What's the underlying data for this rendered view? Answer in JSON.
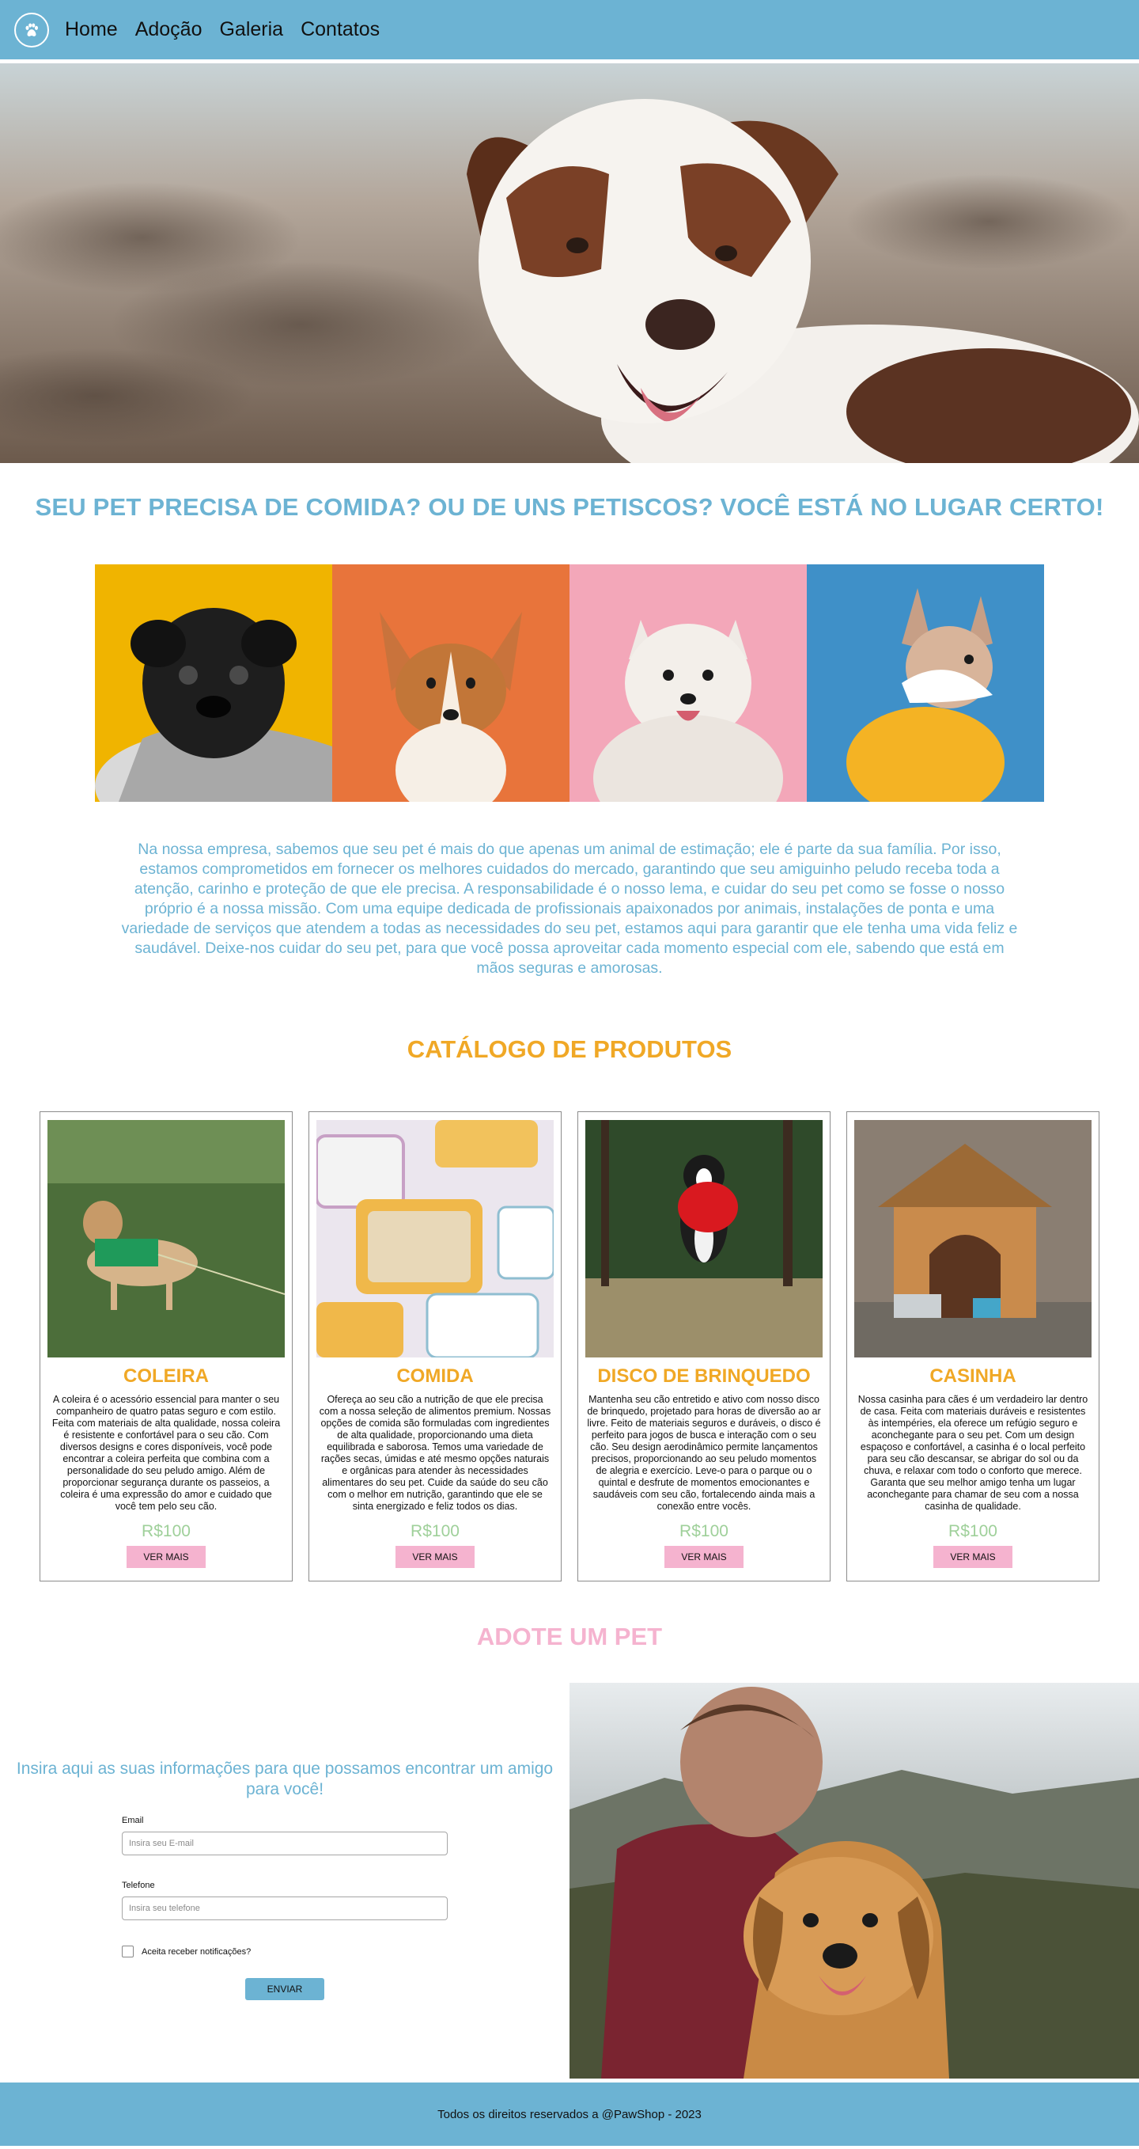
{
  "nav": {
    "logo_icon": "paw-icon",
    "links": [
      "Home",
      "Adoção",
      "Galeria",
      "Contatos"
    ]
  },
  "hero": {
    "image": "dog-hero-photo"
  },
  "tagline": "SEU PET PRECISA DE COMIDA? OU DE UNS PETISCOS? VOCÊ ESTÁ NO LUGAR CERTO!",
  "pets": [
    "pug",
    "corgi",
    "samoyed",
    "french-bulldog"
  ],
  "about": "Na nossa empresa, sabemos que seu pet é mais do que apenas um animal de estimação; ele é parte da sua família. Por isso, estamos comprometidos em fornecer os melhores cuidados do mercado, garantindo que seu amiguinho peludo receba toda a atenção, carinho e proteção de que ele precisa. A responsabilidade é o nosso lema, e cuidar do seu pet como se fosse o nosso próprio é a nossa missão. Com uma equipe dedicada de profissionais apaixonados por animais, instalações de ponta e uma variedade de serviços que atendem a todas as necessidades do seu pet, estamos aqui para garantir que ele tenha uma vida feliz e saudável. Deixe-nos cuidar do seu pet, para que você possa aproveitar cada momento especial com ele, sabendo que está em mãos seguras e amorosas.",
  "catalog": {
    "title": "CATÁLOGO DE PRODUTOS",
    "products": [
      {
        "name": "COLEIRA",
        "description": "A coleira é o acessório essencial para manter o seu companheiro de quatro patas seguro e com estilo. Feita com materiais de alta qualidade, nossa coleira é resistente e confortável para o seu cão. Com diversos designs e cores disponíveis, você pode encontrar a coleira perfeita que combina com a personalidade do seu peludo amigo. Além de proporcionar segurança durante os passeios, a coleira é uma expressão do amor e cuidado que você tem pelo seu cão.",
        "price": "R$100",
        "button": "VER MAIS"
      },
      {
        "name": "COMIDA",
        "description": "Ofereça ao seu cão a nutrição de que ele precisa com a nossa seleção de alimentos premium. Nossas opções de comida são formuladas com ingredientes de alta qualidade, proporcionando uma dieta equilibrada e saborosa. Temos uma variedade de rações secas, úmidas e até mesmo opções naturais e orgânicas para atender às necessidades alimentares do seu pet. Cuide da saúde do seu cão com o melhor em nutrição, garantindo que ele se sinta energizado e feliz todos os dias.",
        "price": "R$100",
        "button": "VER MAIS"
      },
      {
        "name": "DISCO DE BRINQUEDO",
        "description": "Mantenha seu cão entretido e ativo com nosso disco de brinquedo, projetado para horas de diversão ao ar livre. Feito de materiais seguros e duráveis, o disco é perfeito para jogos de busca e interação com o seu cão. Seu design aerodinâmico permite lançamentos precisos, proporcionando ao seu peludo momentos de alegria e exercício. Leve-o para o parque ou o quintal e desfrute de momentos emocionantes e saudáveis com seu cão, fortalecendo ainda mais a conexão entre vocês.",
        "price": "R$100",
        "button": "VER MAIS"
      },
      {
        "name": "CASINHA",
        "description": "Nossa casinha para cães é um verdadeiro lar dentro de casa. Feita com materiais duráveis e resistentes às intempéries, ela oferece um refúgio seguro e aconchegante para o seu pet. Com um design espaçoso e confortável, a casinha é o local perfeito para seu cão descansar, se abrigar do sol ou da chuva, e relaxar com todo o conforto que merece. Garanta que seu melhor amigo tenha um lugar aconchegante para chamar de seu com a nossa casinha de qualidade.",
        "price": "R$100",
        "button": "VER MAIS"
      }
    ]
  },
  "adopt": {
    "title": "ADOTE UM PET",
    "intro": "Insira aqui as suas informações para que possamos encontrar um amigo para você!",
    "email_label": "Email",
    "email_placeholder": "Insira seu E-mail",
    "phone_label": "Telefone",
    "phone_placeholder": "Insira seu telefone",
    "checkbox_label": "Aceita receber notificações?",
    "submit": "ENVIAR"
  },
  "footer": "Todos os direitos reservados a @PawShop - 2023",
  "colors": {
    "primary_blue": "#6cb3d3",
    "accent_orange": "#f0a826",
    "accent_pink": "#f5b3cf",
    "price_green": "#9fd09a"
  }
}
